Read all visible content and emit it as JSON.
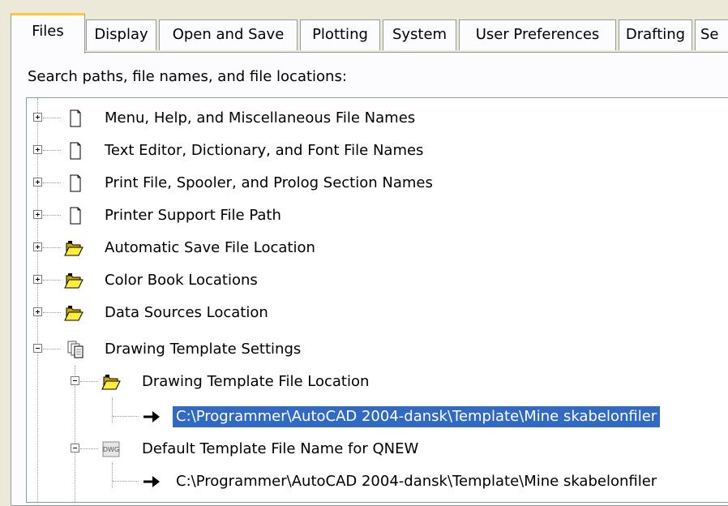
{
  "tabs": [
    {
      "label": "Files",
      "active": true
    },
    {
      "label": "Display"
    },
    {
      "label": "Open and Save"
    },
    {
      "label": "Plotting"
    },
    {
      "label": "System"
    },
    {
      "label": "User Preferences"
    },
    {
      "label": "Drafting"
    },
    {
      "label": "Se"
    }
  ],
  "heading": "Search paths, file names, and file locations:",
  "tree": [
    {
      "label": "Menu, Help, and Miscellaneous File Names",
      "icon": "file-icon",
      "expander": "plus"
    },
    {
      "label": "Text Editor, Dictionary, and Font File Names",
      "icon": "file-icon",
      "expander": "plus"
    },
    {
      "label": "Print File, Spooler, and Prolog Section Names",
      "icon": "file-icon",
      "expander": "plus"
    },
    {
      "label": "Printer Support File Path",
      "icon": "file-icon",
      "expander": "plus"
    },
    {
      "label": "Automatic Save File Location",
      "icon": "folder-icon",
      "expander": "plus"
    },
    {
      "label": "Color Book Locations",
      "icon": "folder-icon",
      "expander": "plus"
    },
    {
      "label": "Data Sources Location",
      "icon": "folder-icon",
      "expander": "plus"
    },
    {
      "label": "Drawing Template Settings",
      "icon": "multi-file-icon",
      "expander": "minus"
    },
    {
      "label": "Drawing Template File Location",
      "icon": "folder-icon",
      "expander": "minus"
    },
    {
      "label": "C:\\Programmer\\AutoCAD 2004-dansk\\Template\\Mine skabelonfiler",
      "icon": "arrow-icon",
      "selected": true
    },
    {
      "label": "Default Template File Name for QNEW",
      "icon": "dwg-file-icon",
      "expander": "minus"
    },
    {
      "label": "C:\\Programmer\\AutoCAD 2004-dansk\\Template\\Mine skabelonfiler",
      "icon": "arrow-icon"
    }
  ],
  "colors": {
    "selection": "#316ac5",
    "active_tab_accent": "#ffc83c",
    "folder": "#ffeb3b"
  }
}
